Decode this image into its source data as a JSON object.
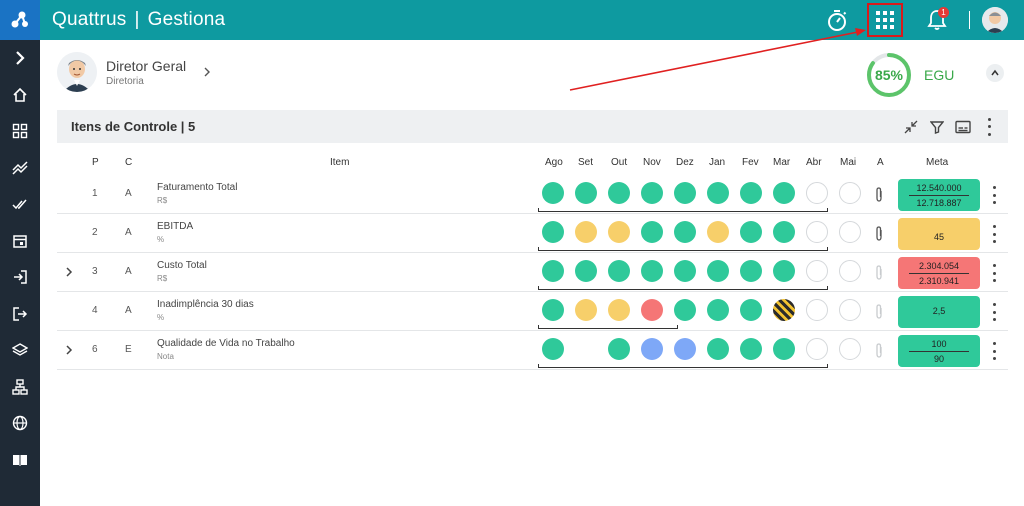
{
  "app": {
    "brand": "Quattrus",
    "product": "Gestiona",
    "separator": "|"
  },
  "topbar": {
    "notifications_count": "1"
  },
  "profile": {
    "name": "Diretor Geral",
    "role": "Diretoria"
  },
  "egu": {
    "value": "85%",
    "label": "EGU",
    "progress_percent": 85
  },
  "panel": {
    "title": "Itens de Controle | 5"
  },
  "columns": {
    "p": "P",
    "c": "C",
    "item": "Item",
    "months": [
      "Ago",
      "Set",
      "Out",
      "Nov",
      "Dez",
      "Jan",
      "Fev",
      "Mar",
      "Abr",
      "Mai"
    ],
    "a": "A",
    "meta": "Meta"
  },
  "rows": [
    {
      "expandable": false,
      "p": "1",
      "c": "A",
      "name": "Faturamento Total",
      "unit": "R$",
      "status": [
        "g",
        "g",
        "g",
        "g",
        "g",
        "g",
        "g",
        "g",
        "e",
        "e"
      ],
      "meta_color": "#2fc99a",
      "meta_l1": "12.540.000",
      "meta_l2": "12.718.887",
      "clip": true
    },
    {
      "expandable": false,
      "p": "2",
      "c": "A",
      "name": "EBITDA",
      "unit": "%",
      "status": [
        "g",
        "y",
        "y",
        "g",
        "g",
        "y",
        "g",
        "g",
        "e",
        "e"
      ],
      "meta_color": "#f7cf6a",
      "meta_l1": "",
      "meta_l2": "45",
      "clip": true
    },
    {
      "expandable": true,
      "p": "3",
      "c": "A",
      "name": "Custo Total",
      "unit": "R$",
      "status": [
        "g",
        "g",
        "g",
        "g",
        "g",
        "g",
        "g",
        "g",
        "e",
        "e"
      ],
      "meta_color": "#f57676",
      "meta_l1": "2.304.054",
      "meta_l2": "2.310.941",
      "clip": false
    },
    {
      "expandable": false,
      "p": "4",
      "c": "A",
      "name": "Inadimplência 30 dias",
      "unit": "%",
      "status": [
        "g",
        "y",
        "y",
        "r",
        "g",
        "g",
        "g",
        "h",
        "e",
        "e"
      ],
      "meta_color": "#2fc99a",
      "meta_l1": "2,5",
      "meta_l2": "",
      "clip": false
    },
    {
      "expandable": true,
      "p": "6",
      "c": "E",
      "name": "Qualidade de Vida no Trabalho",
      "unit": "Nota",
      "status": [
        "g",
        "",
        "g",
        "b",
        "b",
        "g",
        "g",
        "g",
        "e",
        "e"
      ],
      "meta_color": "#2fc99a",
      "meta_l1": "100",
      "meta_l2": "90",
      "clip": false
    }
  ],
  "colors": {
    "topbar": "#0e9aa0",
    "sidebar": "#1f2a36",
    "green": "#2fc99a",
    "yellow": "#f7cf6a",
    "red": "#f57676",
    "blue": "#7ea8f7",
    "highlight": "#d91a1a"
  }
}
